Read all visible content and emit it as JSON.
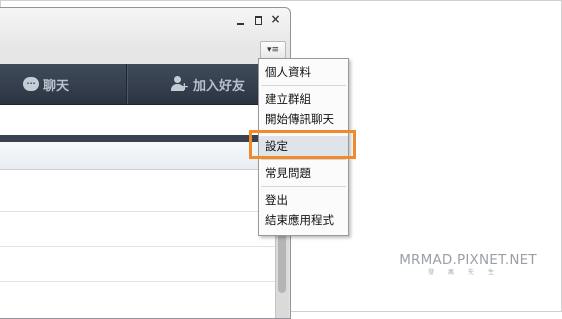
{
  "window": {
    "minimize_symbol": "",
    "maximize_symbol": "",
    "close_symbol": "×",
    "menu_trigger_symbol": "▾≡"
  },
  "nav": {
    "tabs": [
      {
        "label": "聊天",
        "icon": "chat-bubble-icon",
        "icon_glyph": "···"
      },
      {
        "label": "加入好友",
        "icon": "add-friend-icon",
        "icon_glyph": "+"
      }
    ]
  },
  "menu": {
    "items": [
      {
        "label": "個人資料"
      },
      {
        "label": "建立群組"
      },
      {
        "label": "開始傳訊聊天"
      },
      {
        "label": "設定"
      },
      {
        "label": "常見問題"
      },
      {
        "label": "登出"
      },
      {
        "label": "結束應用程式"
      }
    ],
    "highlighted_item": "設定"
  },
  "colors": {
    "highlight_border": "#f08a2c",
    "nav_bar": "#343e4c"
  },
  "watermark": {
    "main": "MRMAD.PIXNET.NET",
    "sub": "發瘋先生"
  }
}
